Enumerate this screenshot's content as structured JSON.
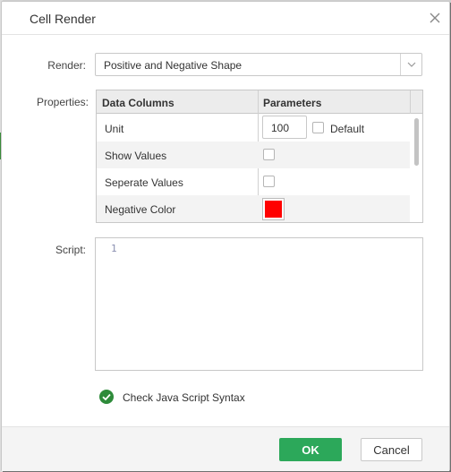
{
  "dialog": {
    "title": "Cell Render",
    "close_icon": "close-icon"
  },
  "render": {
    "label": "Render:",
    "value": "Positive and Negative Shape",
    "arrow_icon": "chevron-down-icon"
  },
  "properties": {
    "label": "Properties:",
    "columns": [
      "Data Columns",
      "Parameters"
    ],
    "rows": [
      {
        "label": "Unit",
        "value": "100",
        "default_label": "Default",
        "default_checked": false
      },
      {
        "label": "Show Values",
        "checked": false
      },
      {
        "label": "Seperate Values",
        "checked": false
      },
      {
        "label": "Negative Color",
        "color": "#ff0000"
      }
    ]
  },
  "script": {
    "label": "Script:",
    "line_numbers": [
      "1"
    ],
    "content": ""
  },
  "syntax_check": {
    "label": "Check Java Script Syntax",
    "icon": "check-circle-icon",
    "icon_color": "#2e8b3a"
  },
  "footer": {
    "ok_label": "OK",
    "cancel_label": "Cancel",
    "ok_color": "#2ca85a"
  }
}
